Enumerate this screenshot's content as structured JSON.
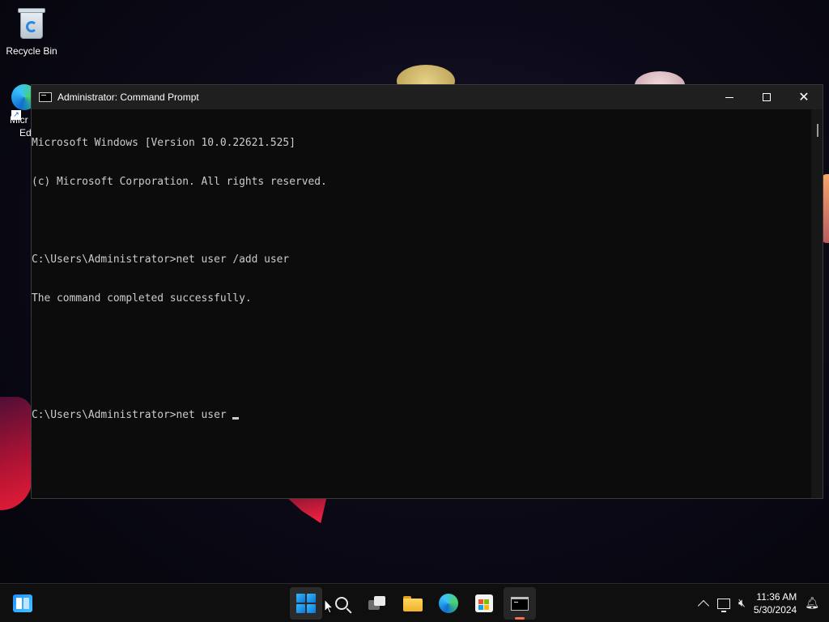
{
  "desktop": {
    "recycle_bin_label": "Recycle Bin",
    "edge_label_line1": "Micr",
    "edge_label_line2": "Ed"
  },
  "window": {
    "title": "Administrator: Command Prompt",
    "icon": "console-icon",
    "controls": {
      "minimize": "minimize-icon",
      "maximize": "maximize-icon",
      "close": "✕"
    },
    "console_lines": [
      "Microsoft Windows [Version 10.0.22621.525]",
      "(c) Microsoft Corporation. All rights reserved.",
      "",
      "C:\\Users\\Administrator>net user /add user",
      "The command completed successfully.",
      "",
      "",
      "C:\\Users\\Administrator>net user "
    ],
    "background_color": "#0c0c0c",
    "text_color": "#cccccc"
  },
  "taskbar": {
    "widgets_icon": "widgets-icon",
    "apps": [
      {
        "name": "start",
        "icon": "windows-logo-icon"
      },
      {
        "name": "search",
        "icon": "search-icon"
      },
      {
        "name": "task-view",
        "icon": "task-view-icon"
      },
      {
        "name": "file-explorer",
        "icon": "folder-icon"
      },
      {
        "name": "edge",
        "icon": "edge-icon"
      },
      {
        "name": "store",
        "icon": "store-icon"
      },
      {
        "name": "command-prompt",
        "icon": "terminal-icon",
        "active": true
      }
    ],
    "active_indicator_color": "#f7704e",
    "tray": {
      "time": "11:36 AM",
      "date": "5/30/2024",
      "volume_glyph": "🔇︎",
      "bell_glyph": "🔔︎"
    }
  }
}
